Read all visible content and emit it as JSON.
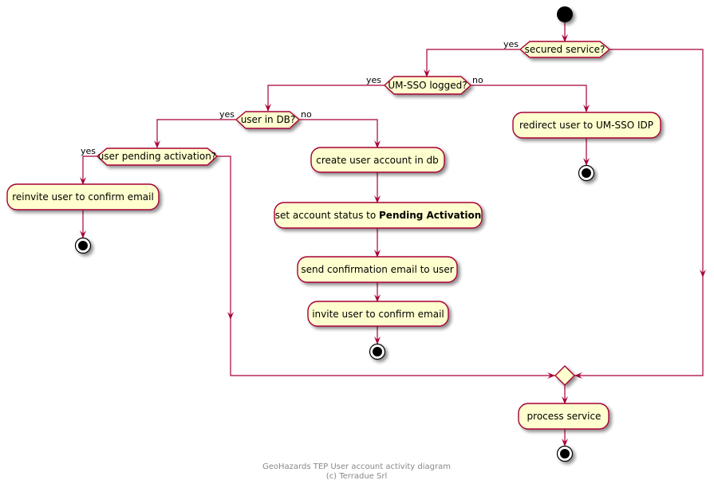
{
  "colors": {
    "line": "#A80036",
    "fill": "#FEFECE",
    "footer_text": "#888888"
  },
  "diagram": {
    "start": {
      "name": "start-node"
    },
    "decisions": [
      {
        "id": "d1",
        "text": "secured service?",
        "yes_label": "yes",
        "no_label": ""
      },
      {
        "id": "d2",
        "text": "UM-SSO logged?",
        "yes_label": "yes",
        "no_label": "no"
      },
      {
        "id": "d3",
        "text": "user in DB?",
        "yes_label": "yes",
        "no_label": "no"
      },
      {
        "id": "d4",
        "text": "user pending activation?",
        "yes_label": "yes",
        "no_label": ""
      }
    ],
    "activities": [
      {
        "id": "a_redirect",
        "text": "redirect user to UM-SSO IDP"
      },
      {
        "id": "a_create",
        "text": "create user account in db"
      },
      {
        "id": "a_status_prefix",
        "text": "set account status to "
      },
      {
        "id": "a_status_bold",
        "text": "Pending Activation"
      },
      {
        "id": "a_send",
        "text": "send confirmation email to user"
      },
      {
        "id": "a_invite",
        "text": "invite user to confirm email"
      },
      {
        "id": "a_reinvite",
        "text": "reinvite user to confirm email"
      },
      {
        "id": "a_process",
        "text": "process service"
      }
    ],
    "stops": 4
  },
  "footer": {
    "line1": "GeoHazards TEP User account activity diagram",
    "line2": "(c) Terradue Srl"
  }
}
